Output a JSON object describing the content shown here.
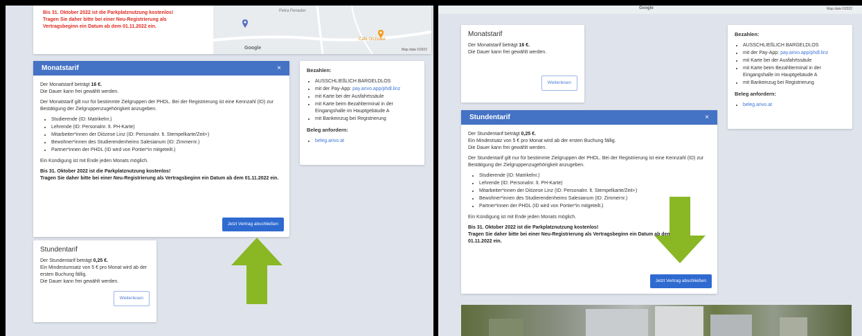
{
  "left": {
    "map": {
      "warning_lines": [
        "Bis 31. Oktober 2022 ist die Parkplatznutzung kostenlos!",
        "Tragen Sie daher bitte bei einer Neu-Registrierung als",
        "Vertragsbeginn ein Datum ab dem 01.11.2022 ein."
      ],
      "label_person": "Petra Peneder",
      "label_cafe": "Cafe Orchidee",
      "brand": "Google",
      "credit": "Map data ©2022"
    },
    "monatstarif": {
      "title": "Monatstarif",
      "close": "×",
      "price_prefix": "Der Monatstarif beträgt ",
      "price": "16 €.",
      "duration": "Die Dauer kann frei gewählt werden.",
      "group_intro": "Der Monatstarif gilt nur für bestimmte Zielgruppen der PHDL. Bei der Registrierung ist eine Kennzahl (ID) zur Bestätigung der Zielgruppenzugehörigkeit anzugeben.",
      "groups": [
        "Studierende (ID: Matrikelnr.)",
        "Lehrende (ID: Personalnr. lt. PH-Karte)",
        "Mitarbeiter*innen der Diözese Linz (ID: Personalnr. lt. Stempelkarte/Zeit+)",
        "Bewohner*innen des Studierendenheims Salesianum (ID: Zimmernr.)",
        "Partner*innen der PHDL (ID wird von Portier*in mitgeteilt.)"
      ],
      "cancel": "Ein Kündigung ist mit Ende jeden Monats möglich.",
      "notice1": "Bis 31. Oktober 2022 ist die Parkplatznutzung kostenlos!",
      "notice2": "Tragen Sie daher bitte bei einer Neu-Registrierung als Vertragsbeginn ein Datum ab dem 01.11.2022 ein.",
      "cta": "Jetzt Vertrag abschließen"
    },
    "stundentarif": {
      "title": "Stundentarif",
      "price_prefix": "Der Stundentarif beträgt ",
      "price": "0,25 €.",
      "minimum": "Ein Mindestumsatz von 5 € pro Monat wird ab der ersten Buchung fällig.",
      "duration": "Die Dauer kann frei gewählt werden.",
      "more": "Weiterlesen"
    },
    "payment": {
      "title": "Bezahlen:",
      "items": [
        "AUSSCHLIEßLICH BARGELDLOS",
        "mit der Pay-App: ",
        "mit Karte bei der Ausfahrtssäule",
        "mit Karte beim Bezahlterminal in der Eingangshalle im Hauptgebäude A",
        "mit Bankeinzug bei Registrierung"
      ],
      "app_link": "pay.arivo.app/phdl.linz",
      "receipt_title": "Beleg anfordern:",
      "receipt_link": "beleg.arivo.at"
    }
  },
  "right": {
    "map_strip": {
      "brand": "Google",
      "credit": "Map data ©2022"
    },
    "monatstarif": {
      "title": "Monatstarif",
      "price_prefix": "Der Monatstarif beträgt ",
      "price": "16 €.",
      "duration": "Die Dauer kann frei gewählt werden.",
      "more": "Weiterlesen"
    },
    "stundentarif": {
      "title": "Stundentarif",
      "close": "×",
      "price_prefix": "Der Stundentarif beträgt ",
      "price": "0,25 €.",
      "minimum": "Ein Mindestsatz von 5 € pro Monat wird ab der ersten Buchung fällig.",
      "duration": "Die Dauer kann frei gewählt werden.",
      "group_intro": "Der Stundentarif gilt nur für bestimmte Zielgruppen der PHDL. Bei der Registrierung ist eine Kennzahl (ID) zur Bestätigung der Zielgruppenzugehörigkeit anzugeben.",
      "groups": [
        "Studierende (ID: Matrikelnr.)",
        "Lehrende (ID: Personalnr. lt. PH-Karte)",
        "Mitarbeiter*innen der Diözese Linz (ID: Personalnr. lt. Stempelkarte/Zeit+)",
        "Bewohner*innen des Studierendenheims Salesianum (ID: Zimmernr.)",
        "Partner*innen der PHDL (ID wird von Portier*in mitgeteilt.)"
      ],
      "cancel": "Ein Kündigung ist mit Ende jeden Monats möglich.",
      "notice1": "Bis 31. Oktober 2022 ist die Parkplatznutzung kostenlos!",
      "notice2": "Tragen Sie daher bitte bei einer Neu-Registrierung als Vertragsbeginn ein Datum ab dem 01.11.2022 ein.",
      "cta": "Jetzt Vertrag abschließen"
    },
    "payment": {
      "title": "Bezahlen:",
      "items": [
        "AUSSCHLIEßLICH BARGELDLOS",
        "mit der Pay-App: ",
        "mit Karte bei der Ausfahrtssäule",
        "mit Karte beim Bezahlterminal in der Eingangshalle im Hauptgebäude A",
        "mit Bankeinzug bei Registrierung"
      ],
      "app_link": "pay.arivo.app/phdl.linz",
      "receipt_title": "Beleg anfordern:",
      "receipt_link": "beleg.arivo.at"
    }
  },
  "colors": {
    "header_blue": "#4472c4",
    "button_blue": "#2f6ad0",
    "arrow_green": "#8ab724",
    "warning_red": "#e02a20"
  },
  "icons": [
    "close-icon",
    "map-pin-icon",
    "arrow-up-icon",
    "arrow-down-icon"
  ]
}
